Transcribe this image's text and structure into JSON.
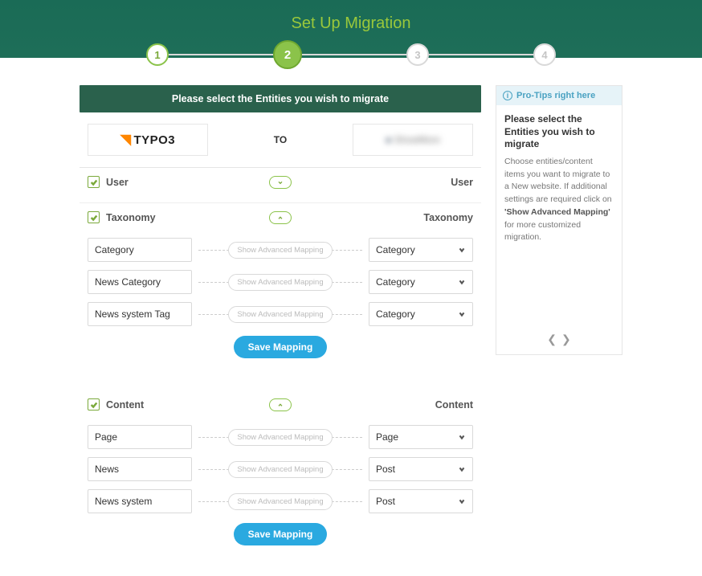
{
  "header": {
    "title": "Set Up Migration"
  },
  "stepper": {
    "steps": [
      "1",
      "2",
      "3",
      "4"
    ],
    "active_index": 1
  },
  "panel": {
    "heading": "Please select the Entities you wish to migrate",
    "source_name": "TYPO3",
    "to_label": "TO",
    "target_name": "ShowMore"
  },
  "buttons": {
    "save_mapping": "Save Mapping",
    "show_advanced": "Show Advanced Mapping"
  },
  "sections": {
    "user": {
      "label_left": "User",
      "label_right": "User",
      "expanded": false
    },
    "taxonomy": {
      "label_left": "Taxonomy",
      "label_right": "Taxonomy",
      "expanded": true,
      "rows": [
        {
          "src": "Category",
          "dst": "Category"
        },
        {
          "src": "News Category",
          "dst": "Category"
        },
        {
          "src": "News system Tag",
          "dst": "Category"
        }
      ]
    },
    "content": {
      "label_left": "Content",
      "label_right": "Content",
      "expanded": true,
      "rows": [
        {
          "src": "Page",
          "dst": "Page"
        },
        {
          "src": "News",
          "dst": "Post"
        },
        {
          "src": "News system",
          "dst": "Post"
        }
      ]
    }
  },
  "tips": {
    "badge": "Pro-Tips right here",
    "title": "Please select the Entities you wish to migrate",
    "body_pre": "Choose entities/content items you want to migrate to a New website. If additional settings are required click on ",
    "body_bold": "'Show Advanced Mapping'",
    "body_post": " for more customized migration."
  }
}
